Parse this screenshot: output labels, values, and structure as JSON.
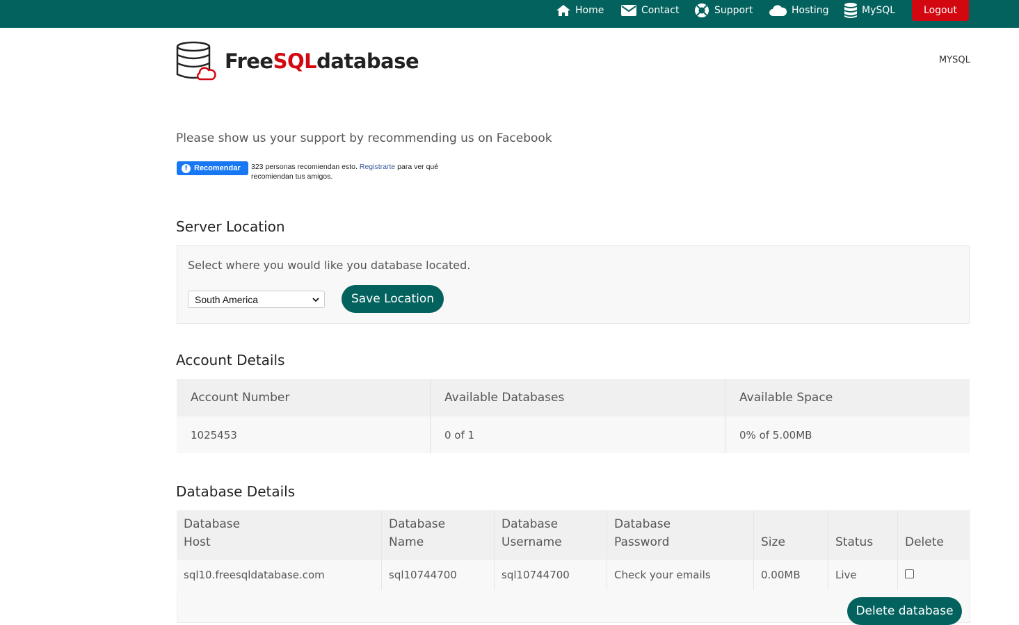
{
  "nav": {
    "home": "Home",
    "contact": "Contact",
    "support": "Support",
    "hosting": "Hosting",
    "mysql": "MySQL",
    "logout": "Logout"
  },
  "logo": {
    "part1": "Free",
    "part2": "SQL",
    "part3": "database"
  },
  "header_right": "MYSQL",
  "support_text": "Please show us your support by recommending us on Facebook",
  "facebook": {
    "button": "Recomendar",
    "text_before": "323 personas recomiendan esto.",
    "link": "Registrarte",
    "text_after": "para ver qué recomiendan tus amigos."
  },
  "server_location": {
    "title": "Server Location",
    "description": "Select where you would like you database located.",
    "selected": "South America",
    "save_label": "Save Location"
  },
  "account": {
    "title": "Account Details",
    "headers": [
      "Account Number",
      "Available Databases",
      "Available Space"
    ],
    "values": [
      "1025453",
      "0 of 1",
      "0% of 5.00MB"
    ]
  },
  "database": {
    "title": "Database Details",
    "headers": [
      "Database Host",
      "Database Name",
      "Database Username",
      "Database Password",
      "Size",
      "Status",
      "Delete"
    ],
    "row": {
      "host": "sql10.freesqldatabase.com",
      "name": "sql10744700",
      "username": "sql10744700",
      "password": "Check your emails",
      "size": "0.00MB",
      "status": "Live",
      "delete_checked": false
    },
    "delete_label": "Delete database"
  },
  "colors": {
    "brand_green": "#04625e",
    "logout_red": "#d3070f",
    "facebook_blue": "#1877f2"
  }
}
